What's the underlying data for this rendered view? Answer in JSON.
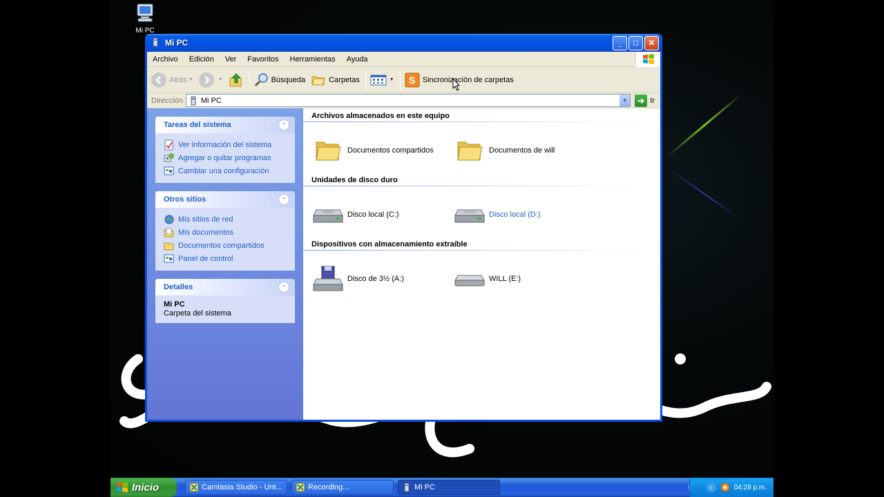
{
  "desktop": {
    "icon_label": "Mi PC"
  },
  "window": {
    "title": "Mi PC"
  },
  "menu": {
    "items": [
      "Archivo",
      "Edición",
      "Ver",
      "Favoritos",
      "Herramientas",
      "Ayuda"
    ]
  },
  "toolbar": {
    "back_label": "Atrás",
    "search_label": "Búsqueda",
    "folders_label": "Carpetas",
    "sync_label": "Sincronización de carpetas"
  },
  "address": {
    "label": "Dirección",
    "value": "Mi PC",
    "go_label": "Ir"
  },
  "sidebar": {
    "system_tasks": {
      "title": "Tareas del sistema",
      "links": [
        "Ver información del sistema",
        "Agregar o quitar programas",
        "Cambiar una configuración"
      ]
    },
    "other_places": {
      "title": "Otros sitios",
      "links": [
        "Mis sitios de red",
        "Mis documentos",
        "Documentos compartidos",
        "Panel de control"
      ]
    },
    "details": {
      "title": "Detalles",
      "name": "Mi PC",
      "description": "Carpeta del sistema"
    }
  },
  "main": {
    "groups": [
      {
        "title": "Archivos almacenados en este equipo",
        "items": [
          "Documentos compartidos",
          "Documentos de will"
        ]
      },
      {
        "title": "Unidades de disco duro",
        "items": [
          "Disco local (C:)",
          "Disco local (D:)"
        ]
      },
      {
        "title": "Dispositivos con almacenamiento extraíble",
        "items": [
          "Disco de 3½ (A:)",
          "WILL (E:)"
        ]
      }
    ]
  },
  "taskbar": {
    "start_label": "Inicio",
    "tasks": [
      "Camtasia Studio - Unt...",
      "Recording...",
      "Mi PC"
    ],
    "language": "ES",
    "clock": "04:28 p.m."
  },
  "colors": {
    "xp_blue": "#0054e3",
    "link_blue": "#215dc6",
    "taskpane_top": "#7ba2e7",
    "start_green": "#3c9a3c"
  }
}
